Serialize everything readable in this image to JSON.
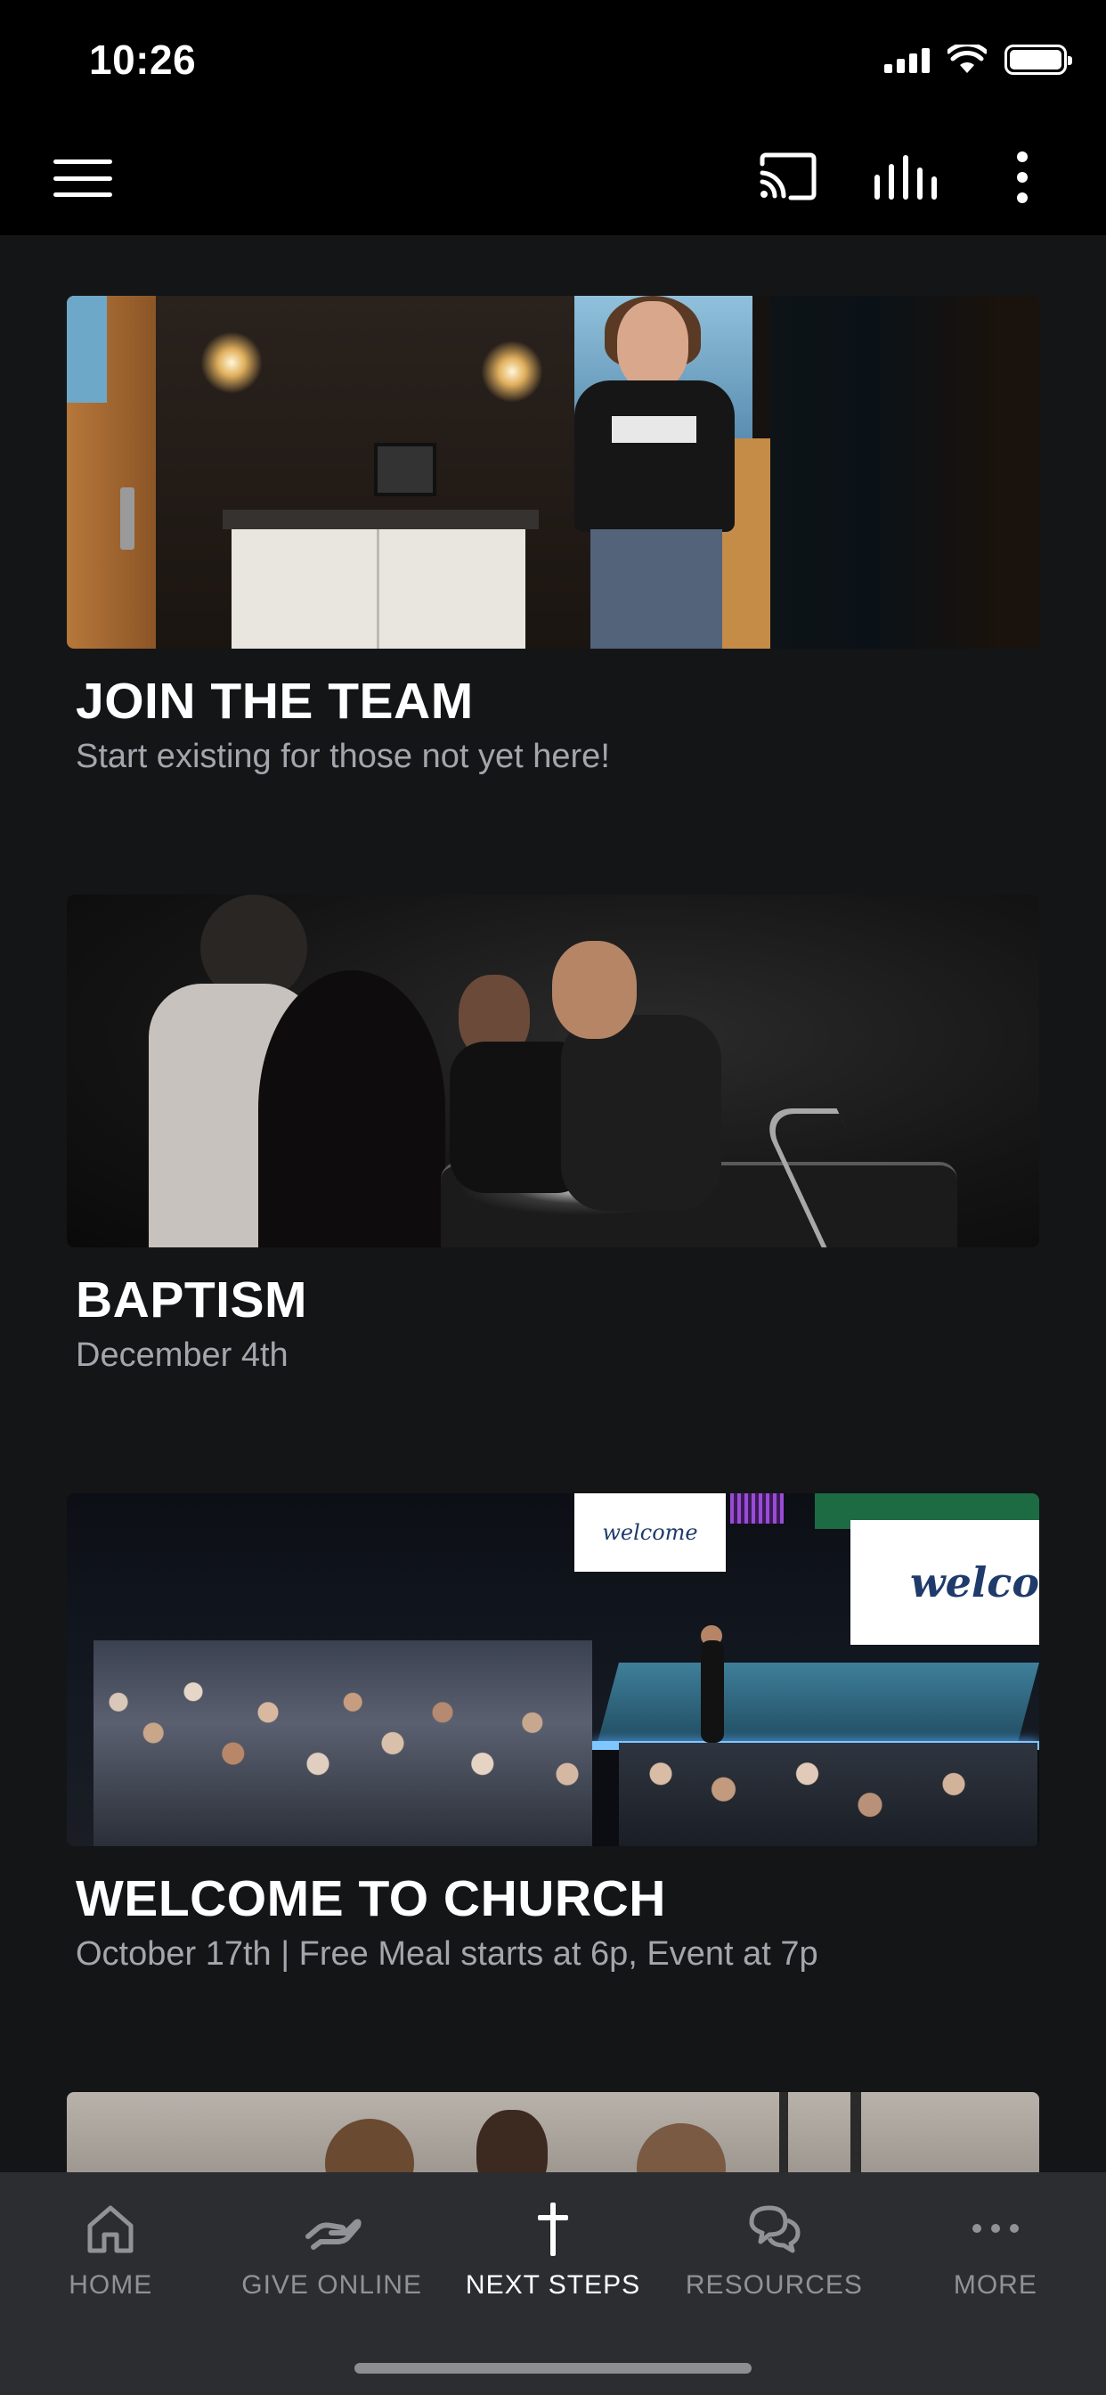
{
  "status_bar": {
    "time": "10:26"
  },
  "app_bar": {
    "menu_icon": "hamburger-icon",
    "actions": [
      "cast-icon",
      "equalizer-icon",
      "more-vertical-icon"
    ]
  },
  "cards": [
    {
      "title": "JOIN THE TEAM",
      "subtitle": "Start existing for those not yet here!"
    },
    {
      "title": "BAPTISM",
      "subtitle": "December 4th"
    },
    {
      "title": "WELCOME TO CHURCH",
      "subtitle": "October 17th | Free Meal starts at 6p, Event at 7p",
      "image_text_left": "welcome",
      "image_text_right": "welco"
    }
  ],
  "tab_bar": {
    "active": "NEXT STEPS",
    "tabs": [
      {
        "label": "HOME",
        "icon": "home-icon"
      },
      {
        "label": "GIVE ONLINE",
        "icon": "give-hand-icon"
      },
      {
        "label": "NEXT STEPS",
        "icon": "cross-icon"
      },
      {
        "label": "RESOURCES",
        "icon": "chat-bubbles-icon"
      },
      {
        "label": "MORE",
        "icon": "more-horizontal-icon"
      }
    ]
  },
  "colors": {
    "background": "#141517",
    "bar_background": "#000000",
    "tab_bar_background": "#2c2d31",
    "subtitle_text": "#a3a6ab",
    "tab_inactive": "#8f9297",
    "tab_active": "#ffffff"
  }
}
